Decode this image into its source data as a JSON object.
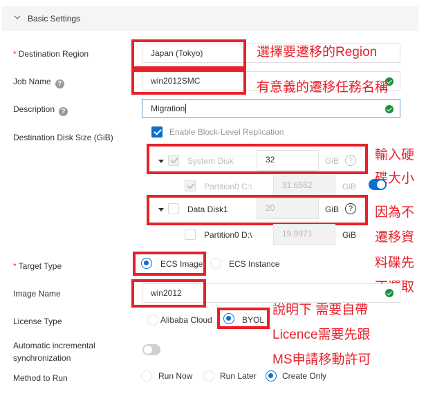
{
  "section": {
    "title": "Basic Settings",
    "icon": "chevron-down-icon"
  },
  "fields": {
    "destination_region": {
      "label": "Destination Region",
      "required_mark": "*",
      "value": "Japan (Tokyo)"
    },
    "job_name": {
      "label": "Job Name",
      "help": "?",
      "value": "win2012SMC"
    },
    "description": {
      "label": "Description",
      "help": "?",
      "value": "Migration"
    },
    "disk_size": {
      "label": "Destination Disk Size (GiB)",
      "block_replication": {
        "label": "Enable Block-Level Replication",
        "checked": true
      },
      "system_disk": {
        "label": "System Disk",
        "value": "32",
        "unit": "GiB",
        "help": "?",
        "checked": true
      },
      "partition_c": {
        "label": "Partition0 C:\\",
        "value": "31.6562",
        "unit": "GiB",
        "checked": true
      },
      "data_disk": {
        "label": "Data Disk1",
        "value": "20",
        "unit": "GiB",
        "help": "?",
        "checked": false
      },
      "partition_d": {
        "label": "Partition0 D:\\",
        "value": "19.9971",
        "unit": "GiB",
        "checked": false
      }
    },
    "target_type": {
      "label": "Target Type",
      "required_mark": "*",
      "options": [
        "ECS Image",
        "ECS Instance"
      ],
      "selected": "ECS Image"
    },
    "image_name": {
      "label": "Image Name",
      "value": "win2012"
    },
    "license_type": {
      "label": "License Type",
      "options": [
        "Alibaba Cloud",
        "BYOL"
      ],
      "selected": "BYOL"
    },
    "auto_sync": {
      "label_line1": "Automatic incremental",
      "label_line2": "synchronization",
      "enabled": false
    },
    "method_to_run": {
      "label": "Method to Run",
      "options": [
        "Run Now",
        "Run Later",
        "Create Only"
      ],
      "selected": "Create Only"
    }
  },
  "annotations": {
    "region_note": "選擇要遷移的Region",
    "job_note": "有意義的遷移任務名稱",
    "disk_note_1": "輸入硬",
    "disk_note_2": "碟大小",
    "data_note_1": "因為不",
    "data_note_2": "遷移資",
    "data_note_3": "料碟先",
    "data_note_4": "不選取",
    "license_note_1": "說明下 需要自帶",
    "license_note_2": "Licence需要先跟",
    "license_note_3": "MS申請移動許可"
  },
  "colors": {
    "accent": "#0b6fcf",
    "annotation": "#e8202a",
    "success": "#1e8e3e",
    "required": "#e5322d"
  }
}
